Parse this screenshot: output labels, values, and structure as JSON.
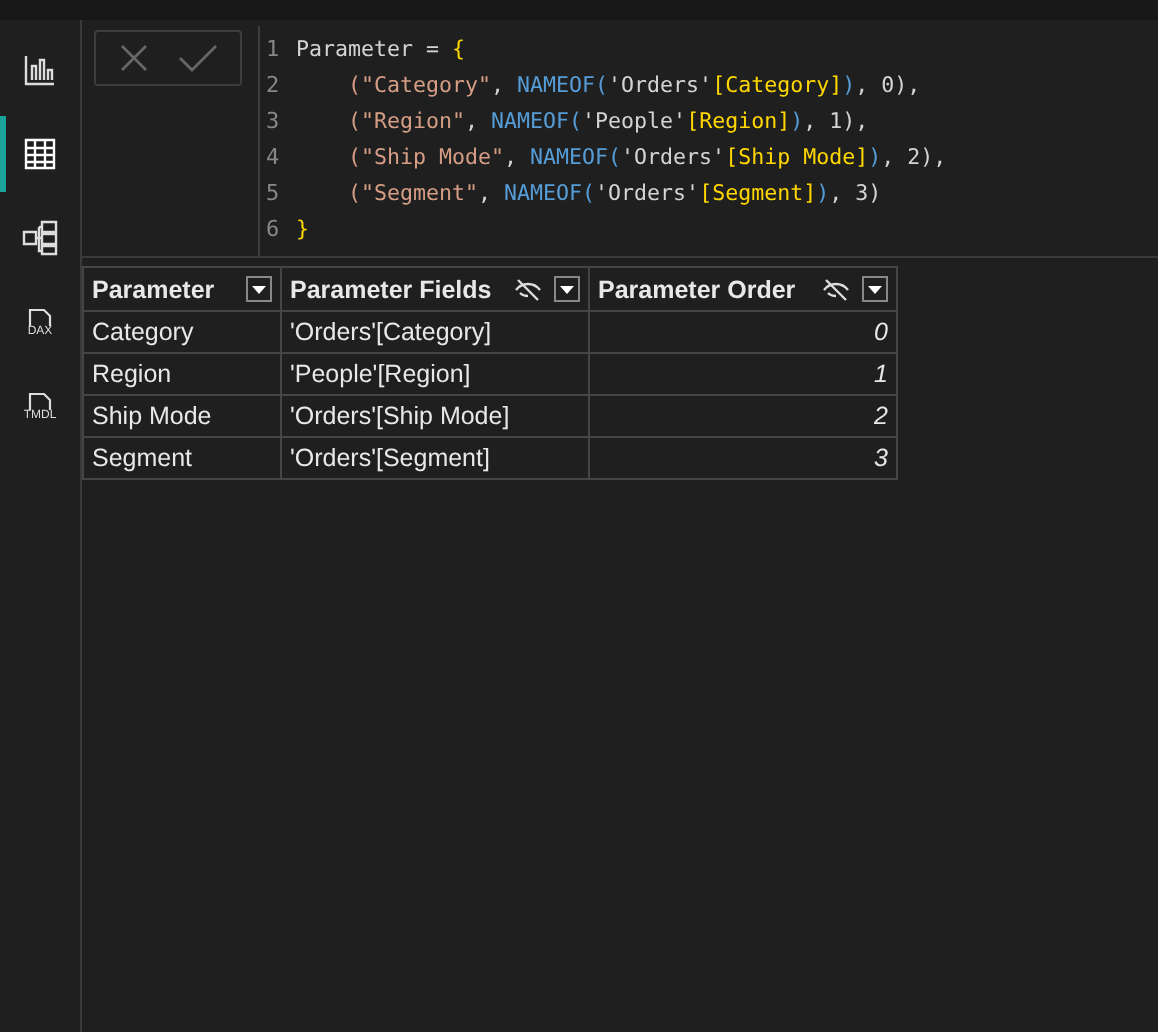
{
  "sidebar": {
    "items": [
      {
        "kind": "report",
        "selected": false
      },
      {
        "kind": "table",
        "selected": true
      },
      {
        "kind": "model",
        "selected": false
      },
      {
        "kind": "file",
        "label": "DAX",
        "selected": false
      },
      {
        "kind": "file",
        "label": "TMDL",
        "selected": false
      }
    ]
  },
  "formula_bar": {
    "lines": [
      {
        "number": "1",
        "tokens": [
          {
            "kind": "plain",
            "text": "Parameter = "
          },
          {
            "kind": "bracket",
            "text": "{"
          }
        ]
      },
      {
        "number": "2",
        "tokens": [
          {
            "kind": "string",
            "text": "    (\"Category\""
          },
          {
            "kind": "plain",
            "text": ", "
          },
          {
            "kind": "func",
            "text": "NAMEOF("
          },
          {
            "kind": "plain",
            "text": "'Orders'"
          },
          {
            "kind": "bracket",
            "text": "[Category]"
          },
          {
            "kind": "func",
            "text": ")"
          },
          {
            "kind": "plain",
            "text": ", 0),"
          }
        ]
      },
      {
        "number": "3",
        "tokens": [
          {
            "kind": "string",
            "text": "    (\"Region\""
          },
          {
            "kind": "plain",
            "text": ", "
          },
          {
            "kind": "func",
            "text": "NAMEOF("
          },
          {
            "kind": "plain",
            "text": "'People'"
          },
          {
            "kind": "bracket",
            "text": "[Region]"
          },
          {
            "kind": "func",
            "text": ")"
          },
          {
            "kind": "plain",
            "text": ", 1),"
          }
        ]
      },
      {
        "number": "4",
        "tokens": [
          {
            "kind": "string",
            "text": "    (\"Ship Mode\""
          },
          {
            "kind": "plain",
            "text": ", "
          },
          {
            "kind": "func",
            "text": "NAMEOF("
          },
          {
            "kind": "plain",
            "text": "'Orders'"
          },
          {
            "kind": "bracket",
            "text": "[Ship Mode]"
          },
          {
            "kind": "func",
            "text": ")"
          },
          {
            "kind": "plain",
            "text": ", 2),"
          }
        ]
      },
      {
        "number": "5",
        "tokens": [
          {
            "kind": "string",
            "text": "    (\"Segment\""
          },
          {
            "kind": "plain",
            "text": ", "
          },
          {
            "kind": "func",
            "text": "NAMEOF("
          },
          {
            "kind": "plain",
            "text": "'Orders'"
          },
          {
            "kind": "bracket",
            "text": "[Segment]"
          },
          {
            "kind": "func",
            "text": ")"
          },
          {
            "kind": "plain",
            "text": ", 3)"
          }
        ]
      },
      {
        "number": "6",
        "tokens": [
          {
            "kind": "bracket",
            "text": "}"
          }
        ]
      }
    ]
  },
  "table": {
    "columns": [
      {
        "name": "Parameter",
        "hidden": false,
        "kind": "text"
      },
      {
        "name": "Parameter Fields",
        "hidden": true,
        "kind": "text"
      },
      {
        "name": "Parameter Order",
        "hidden": true,
        "kind": "number"
      }
    ],
    "rows": [
      [
        "Category",
        "'Orders'[Category]",
        "0"
      ],
      [
        "Region",
        "'People'[Region]",
        "1"
      ],
      [
        "Ship Mode",
        "'Orders'[Ship Mode]",
        "2"
      ],
      [
        "Segment",
        "'Orders'[Segment]",
        "3"
      ]
    ]
  }
}
